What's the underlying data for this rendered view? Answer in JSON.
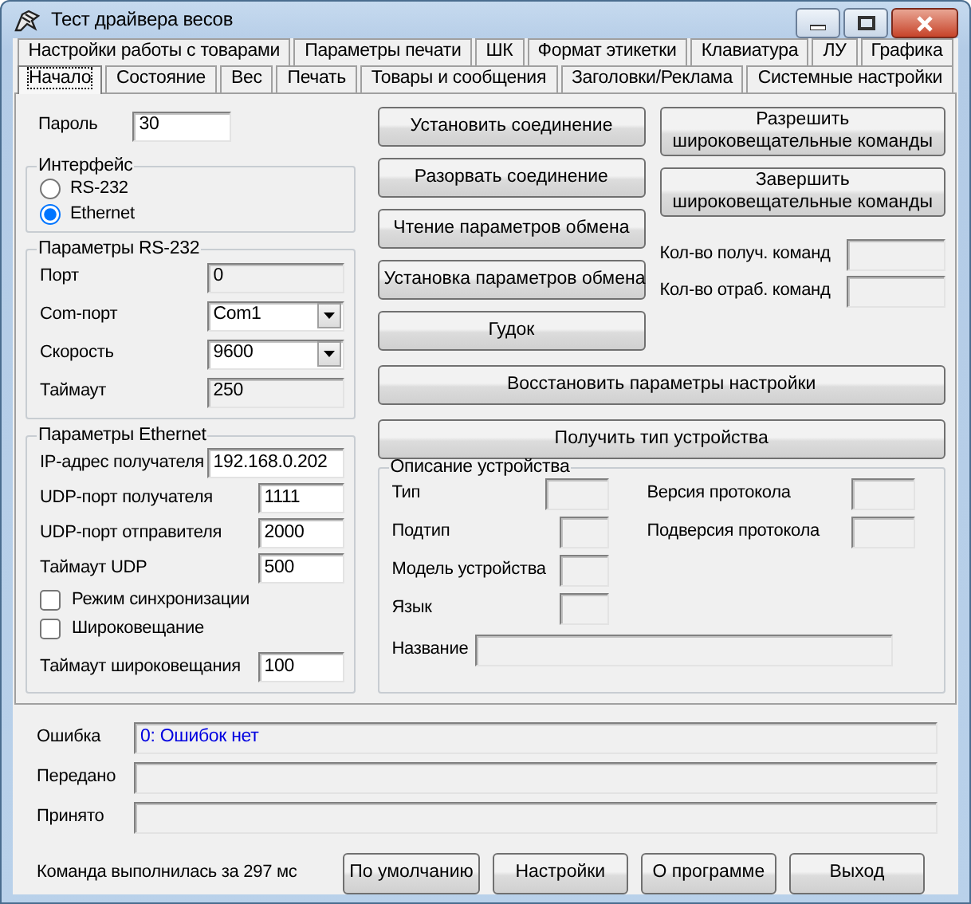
{
  "window": {
    "title": "Тест драйвера весов"
  },
  "tabs_row_1": [
    {
      "label": "Настройки работы с товарами",
      "selected": false
    },
    {
      "label": "Параметры печати",
      "selected": false
    },
    {
      "label": "ШК",
      "selected": false
    },
    {
      "label": "Формат этикетки",
      "selected": false
    },
    {
      "label": "Клавиатура",
      "selected": false
    },
    {
      "label": "ЛУ",
      "selected": false
    },
    {
      "label": "Графика",
      "selected": false
    }
  ],
  "tabs_row_2": [
    {
      "label": "Начало",
      "selected": true
    },
    {
      "label": "Состояние",
      "selected": false
    },
    {
      "label": "Вес",
      "selected": false
    },
    {
      "label": "Печать",
      "selected": false
    },
    {
      "label": "Товары и сообщения",
      "selected": false
    },
    {
      "label": "Заголовки/Реклама",
      "selected": false
    },
    {
      "label": "Системные настройки",
      "selected": false
    }
  ],
  "password": {
    "label": "Пароль",
    "value": "30"
  },
  "interface": {
    "title": "Интерфейс",
    "options": [
      {
        "label": "RS-232",
        "selected": false
      },
      {
        "label": "Ethernet",
        "selected": true
      }
    ]
  },
  "rs232": {
    "title": "Параметры RS-232",
    "fields": [
      {
        "kind": "text",
        "label": "Порт",
        "value": "0",
        "disabled": true
      },
      {
        "kind": "select",
        "label": "Com-порт",
        "value": "Com1",
        "disabled": false
      },
      {
        "kind": "select",
        "label": "Скорость",
        "value": "9600",
        "disabled": false
      },
      {
        "kind": "text",
        "label": "Таймаут",
        "value": "250",
        "disabled": true
      }
    ]
  },
  "ethernet": {
    "title": "Параметры Ethernet",
    "fields": [
      {
        "kind": "wide",
        "label": "IP-адрес получателя",
        "value": "192.168.0.202"
      },
      {
        "kind": "text",
        "label": "UDP-порт получателя",
        "value": "1111"
      },
      {
        "kind": "text",
        "label": "UDP-порт отправителя",
        "value": "2000"
      },
      {
        "kind": "text",
        "label": "Таймаут UDP",
        "value": "500"
      },
      {
        "kind": "checkbox",
        "label": "Режим синхронизации",
        "checked": false
      },
      {
        "kind": "checkbox",
        "label": "Широковещание",
        "checked": false
      },
      {
        "kind": "text",
        "label": "Таймаут широковещания",
        "value": "100"
      }
    ]
  },
  "connection_buttons": [
    "Установить соединение",
    "Разорвать соединение",
    "Чтение параметров обмена",
    "Установка параметров обмена",
    "Гудок"
  ],
  "broadcast_buttons": [
    "Разрешить широковещательные команды",
    "Завершить широковещательные команды"
  ],
  "counters": [
    {
      "label": "Кол-во получ. команд"
    },
    {
      "label": "Кол-во отраб. команд"
    }
  ],
  "wide_buttons": [
    "Восстановить параметры настройки",
    "Получить тип устройства"
  ],
  "device": {
    "title": "Описание устройства",
    "fields_left": [
      {
        "label": "Тип",
        "kind": "wide"
      },
      {
        "label": "Подтип",
        "kind": "narrow"
      },
      {
        "label": "Модель устройства",
        "kind": "narrow"
      },
      {
        "label": "Язык",
        "kind": "narrow"
      }
    ],
    "fields_right": [
      {
        "label": "Версия протокола"
      },
      {
        "label": "Подверсия протокола"
      }
    ],
    "name_label": "Название"
  },
  "log": [
    {
      "label": "Ошибка",
      "value": "0: Ошибок нет"
    },
    {
      "label": "Передано"
    },
    {
      "label": "Принято"
    }
  ],
  "status_message": "Команда выполнилась за 297 мс",
  "footer_buttons": [
    "По умолчанию",
    "Настройки",
    "О программе",
    "Выход"
  ]
}
